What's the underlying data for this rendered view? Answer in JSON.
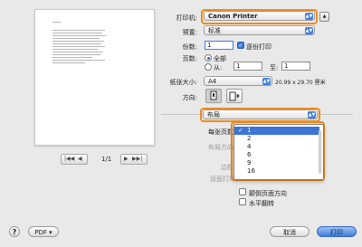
{
  "labels": {
    "printer": "打印机:",
    "preset": "预置:",
    "copies": "份数:",
    "pages": "页数:",
    "paper_size": "纸张大小:",
    "orientation": "方向:",
    "pages_per_sheet": "每张页数",
    "layout_direction": "布局方向",
    "border": "边框",
    "two_sided": "双面打印"
  },
  "printer": {
    "value": "Canon Printer"
  },
  "preset": {
    "value": "标准"
  },
  "copies": {
    "value": "1",
    "collated_label": "逐份打印"
  },
  "pages": {
    "all_label": "全部",
    "from_label": "从:",
    "from_value": "1",
    "to_label": "至:",
    "to_value": "1"
  },
  "paper": {
    "value": "A4",
    "dimensions": "20.99 x 29.70 厘米"
  },
  "section_popup": {
    "value": "布局"
  },
  "per_sheet_menu": {
    "options": [
      "1",
      "2",
      "4",
      "6",
      "9",
      "16"
    ],
    "selected": "1"
  },
  "checkboxes": {
    "reverse": "颠倒页面方向",
    "flip": "水平翻转"
  },
  "preview": {
    "page_count": "1/1"
  },
  "footer": {
    "help": "?",
    "pdf": "PDF ▾",
    "cancel": "取消",
    "print": "打印"
  },
  "colors": {
    "highlight": "#ef8a1f",
    "accent": "#3f7ee0"
  }
}
